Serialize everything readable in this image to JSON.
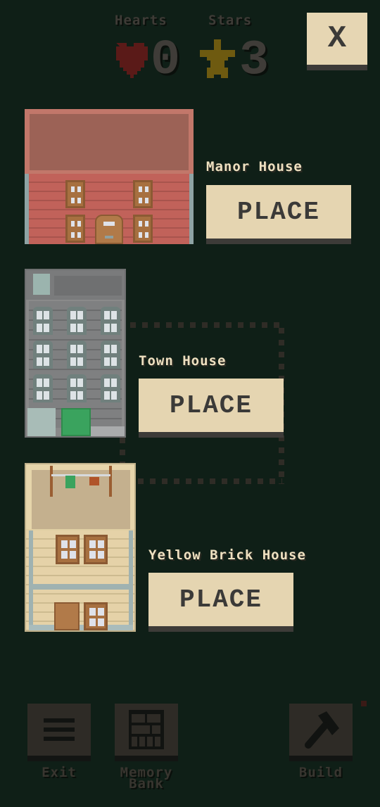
{
  "hud": {
    "hearts_label": "Hearts",
    "hearts_value": "0",
    "stars_label": "Stars",
    "stars_value": "3",
    "heart_icon": "heart-icon",
    "star_icon": "star-icon"
  },
  "close_button": {
    "label": "X"
  },
  "houses": [
    {
      "name": "Manor House",
      "button": "PLACE"
    },
    {
      "name": "Town House",
      "button": "PLACE"
    },
    {
      "name": "Yellow Brick House",
      "button": "PLACE"
    }
  ],
  "toolbar": {
    "exit_label": "Exit",
    "memory_label_1": "Memory",
    "memory_label_2": "Bank",
    "build_label": "Build"
  },
  "colors": {
    "background": "#0f1f17",
    "button_face": "#e5d5b1",
    "button_shadow": "#3d3b38",
    "heart": "#5a1a18",
    "star": "#6e5a10"
  }
}
